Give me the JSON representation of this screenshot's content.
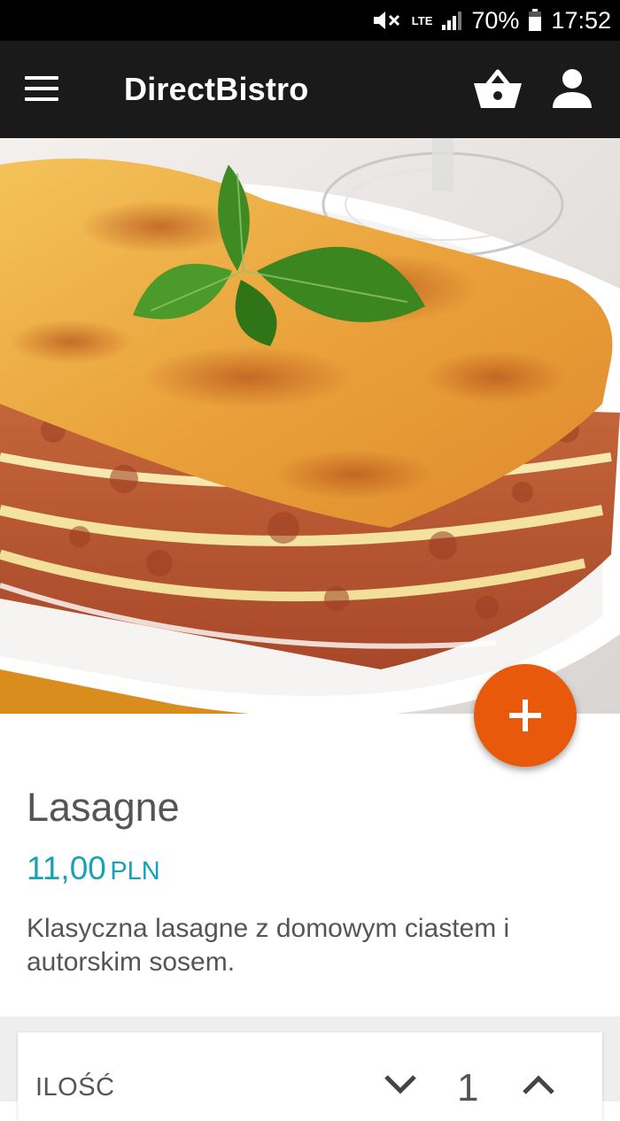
{
  "status_bar": {
    "network": "LTE",
    "battery": "70%",
    "time": "17:52",
    "icons": [
      "mute-icon",
      "signal-icon",
      "battery-icon"
    ]
  },
  "app_bar": {
    "title": "DirectBistro",
    "icons": [
      "menu-icon",
      "basket-icon",
      "user-icon"
    ]
  },
  "product": {
    "name": "Lasagne",
    "price": "11,00",
    "currency": "PLN",
    "description": "Klasyczna lasagne z domowym ciastem i autorskim sosem.",
    "image": "lasagne-photo"
  },
  "actions": {
    "add_icon": "plus-icon",
    "fab_color": "#e8590c"
  },
  "quantity": {
    "label": "ILOŚĆ",
    "value": "1"
  },
  "colors": {
    "accent": "#e8590c",
    "price": "#17a2b8",
    "app_bar": "#1a1a1a"
  }
}
